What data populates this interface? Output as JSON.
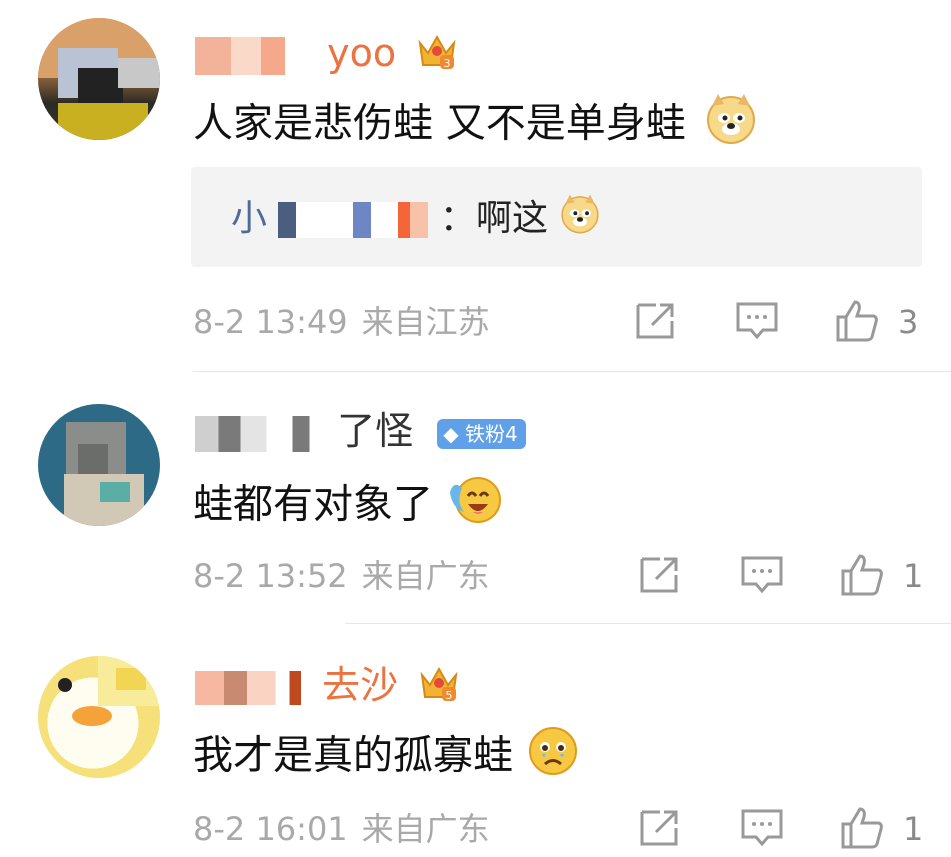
{
  "comments": [
    {
      "username": "yoo",
      "content": "人家是悲伤蛙 又不是单身蛙",
      "reply": {
        "name": "小",
        "colon": "：",
        "text": "啊这"
      },
      "time": "8-2 13:49",
      "location": "来自江苏",
      "likes": "3",
      "crown_level": "3"
    },
    {
      "username": "了怪",
      "username_prefix_hidden": "",
      "badge": "铁粉4",
      "content": "蛙都有对象了",
      "time": "8-2 13:52",
      "location": "来自广东",
      "likes": "1"
    },
    {
      "username": "去沙",
      "content": "我才是真的孤寡蛙",
      "time": "8-2 16:01",
      "location": "来自广东",
      "likes": "1",
      "crown_level": "5"
    }
  ],
  "colors": {
    "vip_name": "#eb7340",
    "reply_name": "#506a9a",
    "meta_text": "#a9a9a9",
    "badge_bg": "#5fa0e8"
  }
}
